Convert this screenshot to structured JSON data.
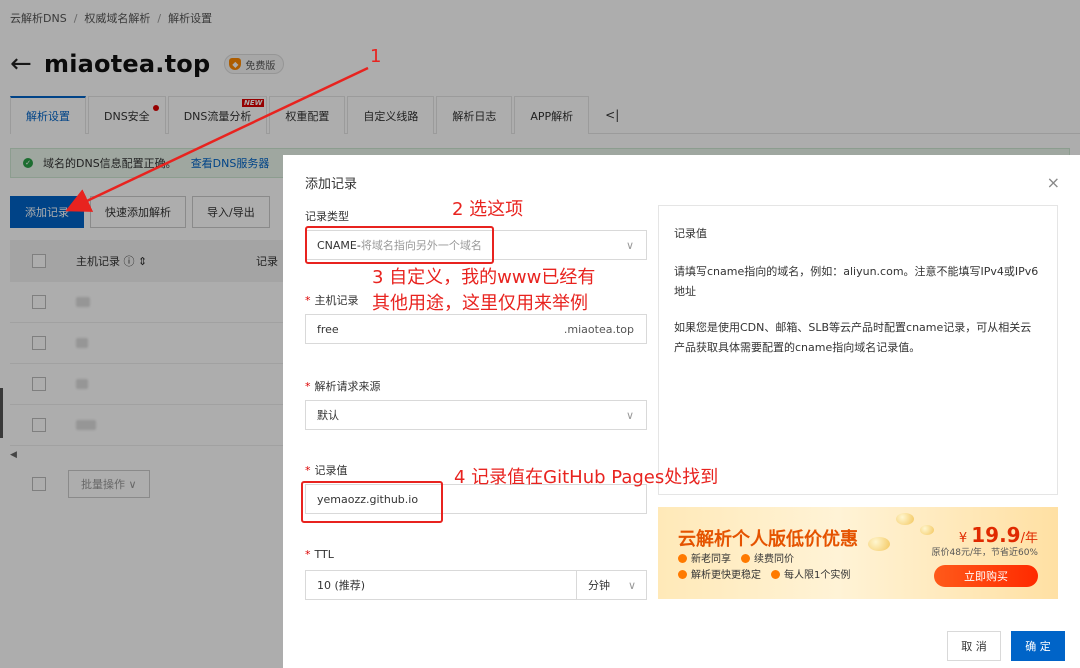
{
  "breadcrumb": [
    "云解析DNS",
    "权威域名解析",
    "解析设置"
  ],
  "header": {
    "domain": "miaotea.top",
    "badge": "免费版"
  },
  "tabs": [
    {
      "label": "解析设置"
    },
    {
      "label": "DNS安全"
    },
    {
      "label": "DNS流量分析",
      "tag": "NEW"
    },
    {
      "label": "权重配置"
    },
    {
      "label": "自定义线路"
    },
    {
      "label": "解析日志"
    },
    {
      "label": "APP解析"
    }
  ],
  "tab_more": "<|",
  "notice": {
    "text": "域名的DNS信息配置正确。",
    "link": "查看DNS服务器"
  },
  "toolbar": {
    "add": "添加记录",
    "quick": "快速添加解析",
    "import": "导入/导出"
  },
  "table": {
    "col_host": "主机记录 ⓘ ⇕",
    "col_type": "记录"
  },
  "batch": "批量操作 ∨",
  "modal": {
    "title": "添加记录",
    "close": "×",
    "record_type": {
      "label": "记录类型",
      "value": "CNAME-",
      "hint": " 将域名指向另外一个域名"
    },
    "host": {
      "label": "主机记录",
      "value": "free",
      "suffix": ".miaotea.top"
    },
    "source": {
      "label": "解析请求来源",
      "value": "默认"
    },
    "record_value": {
      "label": "记录值",
      "value": "yemaozz.github.io"
    },
    "ttl": {
      "label": "TTL",
      "value": "10 (推荐)",
      "unit": "分钟"
    },
    "info": {
      "title": "记录值",
      "p1": "请填写cname指向的域名，例如：aliyun.com。注意不能填写IPv4或IPv6地址",
      "p2": "如果您是使用CDN、邮箱、SLB等云产品时配置cname记录，可从相关云产品获取具体需要配置的cname指向域名记录值。"
    },
    "promo": {
      "title": "云解析个人版低价优惠",
      "tags": [
        "新老同享",
        "续费同价",
        "解析更快更稳定",
        "每人限1个实例"
      ],
      "currency": "¥",
      "price": "19.9",
      "per": "/年",
      "orig": "原价48元/年，节省近60%",
      "buy": "立即购买"
    },
    "cancel": "取 消",
    "ok": "确 定"
  },
  "annotations": {
    "a1": "1",
    "a2": "2 选这项",
    "a3_line1": "3 自定义，我的www已经有",
    "a3_line2": "其他用途，这里仅用来举例",
    "a4": "4 记录值在GitHub Pages处找到"
  },
  "colors": {
    "primary": "#0064c8",
    "annotation": "#e8231f",
    "promo_orange": "#e55300"
  }
}
